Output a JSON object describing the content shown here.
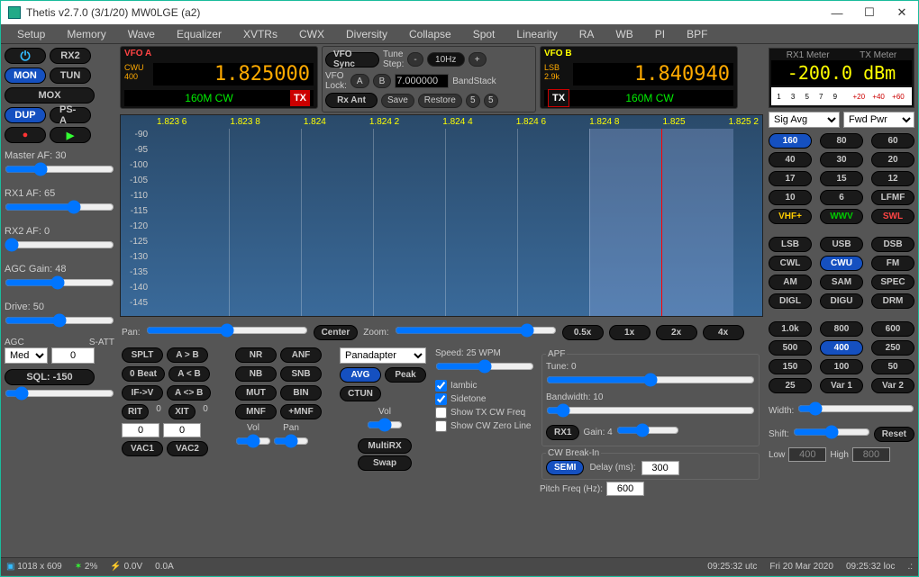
{
  "window": {
    "title": "Thetis v2.7.0 (3/1/20) MW0LGE (a2)"
  },
  "menu": [
    "Setup",
    "Memory",
    "Wave",
    "Equalizer",
    "XVTRs",
    "CWX",
    "Diversity",
    "Collapse",
    "Spot",
    "Linearity",
    "RA",
    "WB",
    "PI",
    "BPF"
  ],
  "left": {
    "rx2": "RX2",
    "mon": "MON",
    "mox": "MOX",
    "tun": "TUN",
    "dup": "DUP",
    "psa": "PS-A",
    "masterAF": "Master AF:  30",
    "rx1AF": "RX1 AF:  65",
    "rx2AF": "RX2 AF:  0",
    "agcGain": "AGC Gain:  48",
    "drive": "Drive:  50",
    "agc": "AGC",
    "satt": "S-ATT",
    "agcVal": "Med",
    "sattVal": "0",
    "sql": "SQL: -150"
  },
  "vfoA": {
    "label": "VFO A",
    "mode": "CWU",
    "filter": "400",
    "freq": "1.825000",
    "band": "160M CW",
    "tx": "TX"
  },
  "vfoCenter": {
    "sync": "VFO Sync",
    "lock": "VFO\nLock:",
    "a": "A",
    "b": "B",
    "rxant": "Rx Ant",
    "tuneStep": "Tune\nStep:",
    "minus": "-",
    "step": "10Hz",
    "plus": "+",
    "freqEntry": "7.000000",
    "bandstack": "BandStack",
    "save": "Save",
    "restore": "Restore",
    "five1": "5",
    "five2": "5"
  },
  "vfoB": {
    "label": "VFO B",
    "mode": "LSB",
    "filter": "2.9k",
    "freq": "1.840940",
    "band": "160M CW"
  },
  "meter": {
    "rx1": "RX1 Meter",
    "tx": "TX Meter",
    "value": "-200.0 dBm",
    "sel1": "Sig Avg",
    "sel2": "Fwd Pwr"
  },
  "zoom": {
    "pan": "Pan:",
    "center": "Center",
    "zoom": "Zoom:",
    "z05": "0.5x",
    "z1": "1x",
    "z2": "2x",
    "z4": "4x"
  },
  "bands": [
    {
      "t": "160",
      "a": 1
    },
    {
      "t": "80"
    },
    {
      "t": "60"
    },
    {
      "t": "40"
    },
    {
      "t": "30"
    },
    {
      "t": "20"
    },
    {
      "t": "17"
    },
    {
      "t": "15"
    },
    {
      "t": "12"
    },
    {
      "t": "10"
    },
    {
      "t": "6"
    },
    {
      "t": "LFMF"
    },
    {
      "t": "VHF+",
      "c": "yellow-txt"
    },
    {
      "t": "WWV",
      "c": "green-txt"
    },
    {
      "t": "SWL",
      "c": "red-txt"
    }
  ],
  "modes": [
    {
      "t": "LSB"
    },
    {
      "t": "USB"
    },
    {
      "t": "DSB"
    },
    {
      "t": "CWL"
    },
    {
      "t": "CWU",
      "a": 1
    },
    {
      "t": "FM"
    },
    {
      "t": "AM"
    },
    {
      "t": "SAM"
    },
    {
      "t": "SPEC"
    },
    {
      "t": "DIGL"
    },
    {
      "t": "DIGU"
    },
    {
      "t": "DRM"
    }
  ],
  "filters": [
    {
      "t": "1.0k"
    },
    {
      "t": "800"
    },
    {
      "t": "600"
    },
    {
      "t": "500"
    },
    {
      "t": "400",
      "a": 1
    },
    {
      "t": "250"
    },
    {
      "t": "150"
    },
    {
      "t": "100"
    },
    {
      "t": "50"
    },
    {
      "t": "25"
    },
    {
      "t": "Var 1"
    },
    {
      "t": "Var 2"
    }
  ],
  "width": "Width:",
  "shift": "Shift:",
  "reset": "Reset",
  "low": "Low",
  "lowVal": "400",
  "high": "High",
  "highVal": "800",
  "bottom": {
    "splt": "SPLT",
    "a2b": "A > B",
    "zeroBeat": "0 Beat",
    "alb": "A < B",
    "ifv": "IF->V",
    "aswap": "A <> B",
    "rit": "RIT",
    "ritVal": "0",
    "xit": "XIT",
    "xitVal": "0",
    "ritNum": "0",
    "xitNum": "0",
    "vac1": "VAC1",
    "vac2": "VAC2",
    "nr": "NR",
    "anf": "ANF",
    "nb": "NB",
    "snb": "SNB",
    "mut": "MUT",
    "bin": "BIN",
    "mnf": "MNF",
    "pmnf": "+MNF",
    "vol": "Vol",
    "panLabel": "Pan",
    "multiRx": "MultiRX",
    "swap": "Swap",
    "dispMode": "Panadapter",
    "avg": "AVG",
    "peak": "Peak",
    "ctun": "CTUN",
    "speed": "Speed:  25 WPM",
    "iambic": "Iambic",
    "sidetone": "Sidetone",
    "showtx": "Show TX CW Freq",
    "showzero": "Show CW Zero Line",
    "apf": "APF",
    "tune": "Tune:   0",
    "bw": "Bandwidth:   10",
    "rx1": "RX1",
    "gain": "Gain:  4",
    "cwbreak": "CW Break-In",
    "semi": "SEMI",
    "delay": "Delay (ms):",
    "delayVal": "300",
    "pitch": "Pitch Freq (Hz):",
    "pitchVal": "600"
  },
  "status": {
    "res": "1018 x 609",
    "cpu": "2%",
    "volt": "0.0V",
    "amp": "0.0A",
    "utc": "09:25:32 utc",
    "date": "Fri 20 Mar 2020",
    "loc": "09:25:32 loc"
  },
  "chart_data": {
    "type": "panadapter",
    "x_ticks": [
      "1.823 6",
      "1.823 8",
      "1.824",
      "1.824 2",
      "1.824 4",
      "1.824 6",
      "1.824 8",
      "1.825",
      "1.825 2"
    ],
    "y_ticks": [
      -90,
      -95,
      -100,
      -105,
      -110,
      -115,
      -120,
      -125,
      -130,
      -135,
      -140,
      -145
    ],
    "center_freq_mhz": 1.825,
    "filter_band_mhz": [
      1.8248,
      1.8252
    ]
  }
}
